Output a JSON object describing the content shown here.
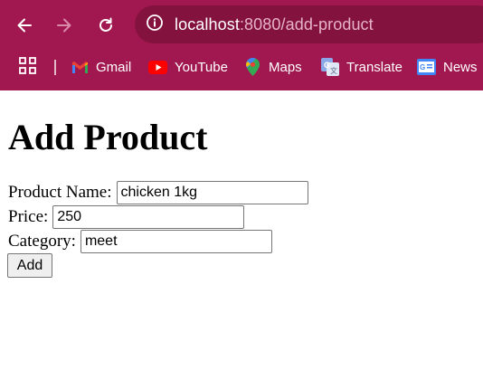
{
  "browser": {
    "url_host": "localhost",
    "url_path": ":8080/add-product",
    "bookmarks": [
      {
        "label": "Gmail",
        "icon": "gmail-icon"
      },
      {
        "label": "YouTube",
        "icon": "youtube-icon"
      },
      {
        "label": "Maps",
        "icon": "maps-icon"
      },
      {
        "label": "Translate",
        "icon": "translate-icon"
      },
      {
        "label": "News",
        "icon": "news-icon"
      }
    ],
    "theme_color": "#a1174f"
  },
  "page": {
    "title": "Add Product",
    "fields": {
      "product_name": {
        "label": "Product Name:",
        "value": "chicken 1kg"
      },
      "price": {
        "label": "Price:",
        "value": "250"
      },
      "category": {
        "label": "Category:",
        "value": "meet"
      }
    },
    "submit_label": "Add"
  }
}
